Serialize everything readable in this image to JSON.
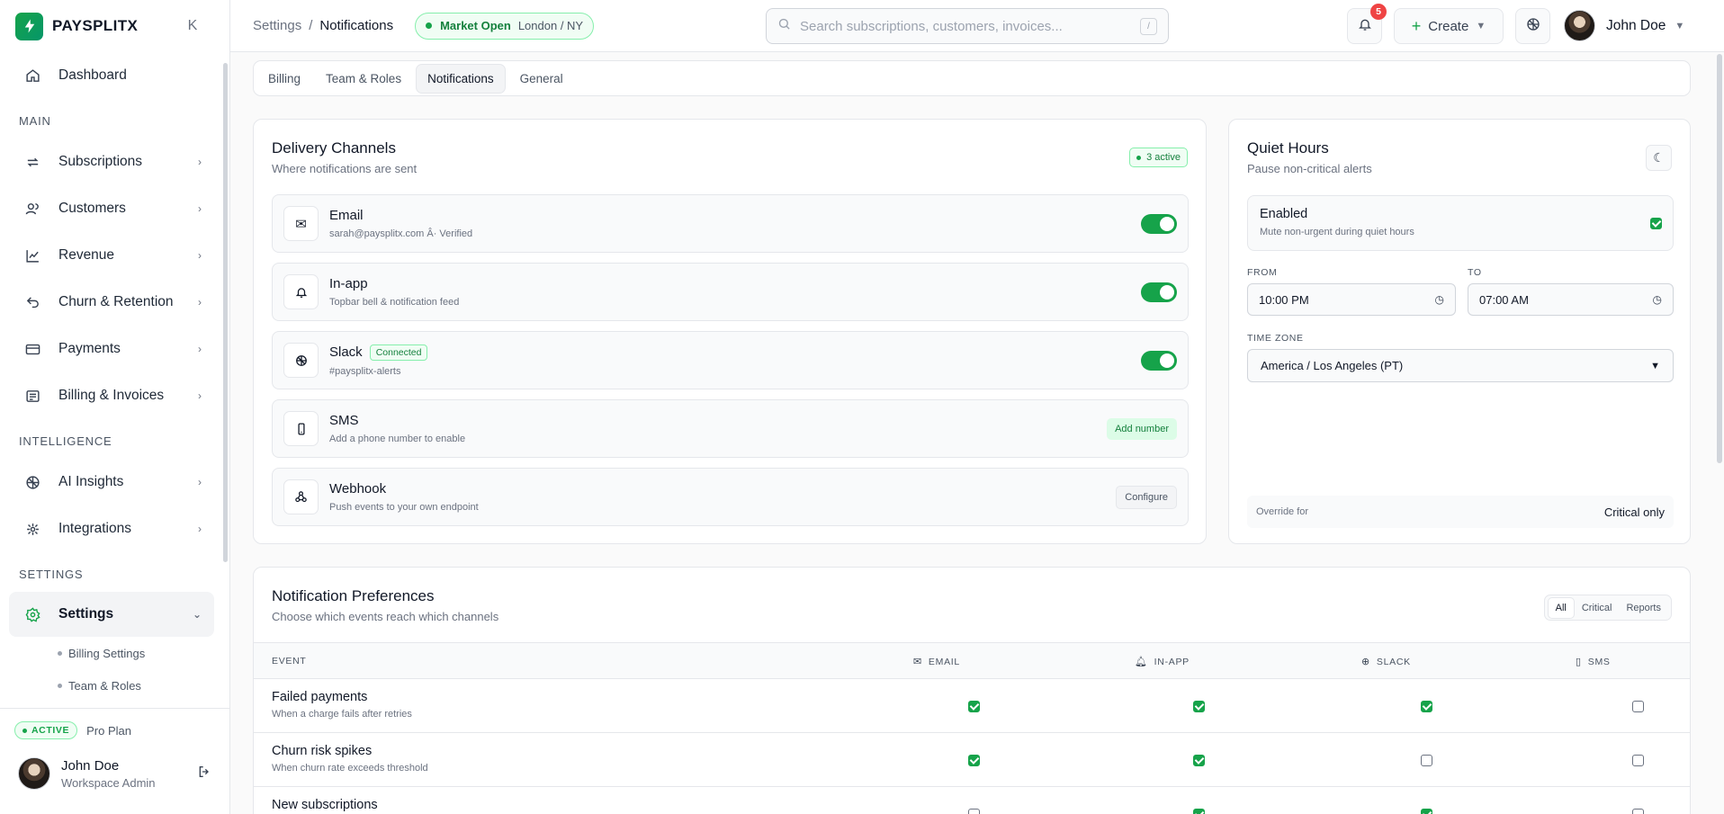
{
  "brand": {
    "name": "PAYSPLITX"
  },
  "sidebar": {
    "collapse_glyph": "K",
    "dashboard": "Dashboard",
    "section_main": "MAIN",
    "main_items": [
      "Subscriptions",
      "Customers",
      "Revenue",
      "Churn & Retention",
      "Payments",
      "Billing & Invoices"
    ],
    "section_intelligence": "INTELLIGENCE",
    "intel_items": [
      "AI Insights",
      "Integrations"
    ],
    "section_settings": "SETTINGS",
    "settings_label": "Settings",
    "settings_sub": [
      "Billing Settings",
      "Team & Roles"
    ],
    "plan_badge": "ACTIVE",
    "plan_name": "Pro Plan",
    "user_name": "John Doe",
    "user_role": "Workspace Admin"
  },
  "topbar": {
    "crumb_root": "Settings",
    "crumb_sep": "/",
    "crumb_current": "Notifications",
    "market_status": "Market Open",
    "market_location": "London / NY",
    "search_placeholder": "Search subscriptions, customers, invoices...",
    "search_shortcut": "/",
    "notif_count": "5",
    "create_label": "Create",
    "user_name": "John Doe"
  },
  "tabs": [
    "Billing",
    "Team & Roles",
    "Notifications",
    "General"
  ],
  "delivery": {
    "title": "Delivery Channels",
    "subtitle": "Where notifications are sent",
    "active_badge": "3 active",
    "channels": [
      {
        "name": "Email",
        "desc": "sarah@paysplitx.com Â· Verified",
        "icon": "✉"
      },
      {
        "name": "In-app",
        "desc": "Topbar bell & notification feed"
      },
      {
        "name": "Slack",
        "desc": "#paysplitx-alerts",
        "tag": "Connected"
      },
      {
        "name": "SMS",
        "desc": "Add a phone number to enable",
        "action": "Add number"
      },
      {
        "name": "Webhook",
        "desc": "Push events to your own endpoint",
        "action": "Configure"
      }
    ]
  },
  "quiet": {
    "title": "Quiet Hours",
    "subtitle": "Pause non-critical alerts",
    "enabled_title": "Enabled",
    "enabled_desc": "Mute non-urgent during quiet hours",
    "from_label": "FROM",
    "from_value": "10:00 PM",
    "to_label": "TO",
    "to_value": "07:00 AM",
    "tz_label": "TIME ZONE",
    "tz_value": "America / Los Angeles (PT)",
    "override_label": "Override for",
    "override_value": "Critical only"
  },
  "prefs": {
    "title": "Notification Preferences",
    "subtitle": "Choose which events reach which channels",
    "filters": [
      "All",
      "Critical",
      "Reports"
    ],
    "columns": [
      "EVENT",
      "EMAIL",
      "IN-APP",
      "SLACK",
      "SMS"
    ],
    "rows": [
      {
        "name": "Failed payments",
        "desc": "When a charge fails after retries",
        "checks": [
          true,
          true,
          true,
          false
        ]
      },
      {
        "name": "Churn risk spikes",
        "desc": "When churn rate exceeds threshold",
        "checks": [
          true,
          true,
          false,
          false
        ]
      },
      {
        "name": "New subscriptions",
        "desc": "",
        "checks": [
          false,
          true,
          true,
          false
        ]
      }
    ]
  }
}
